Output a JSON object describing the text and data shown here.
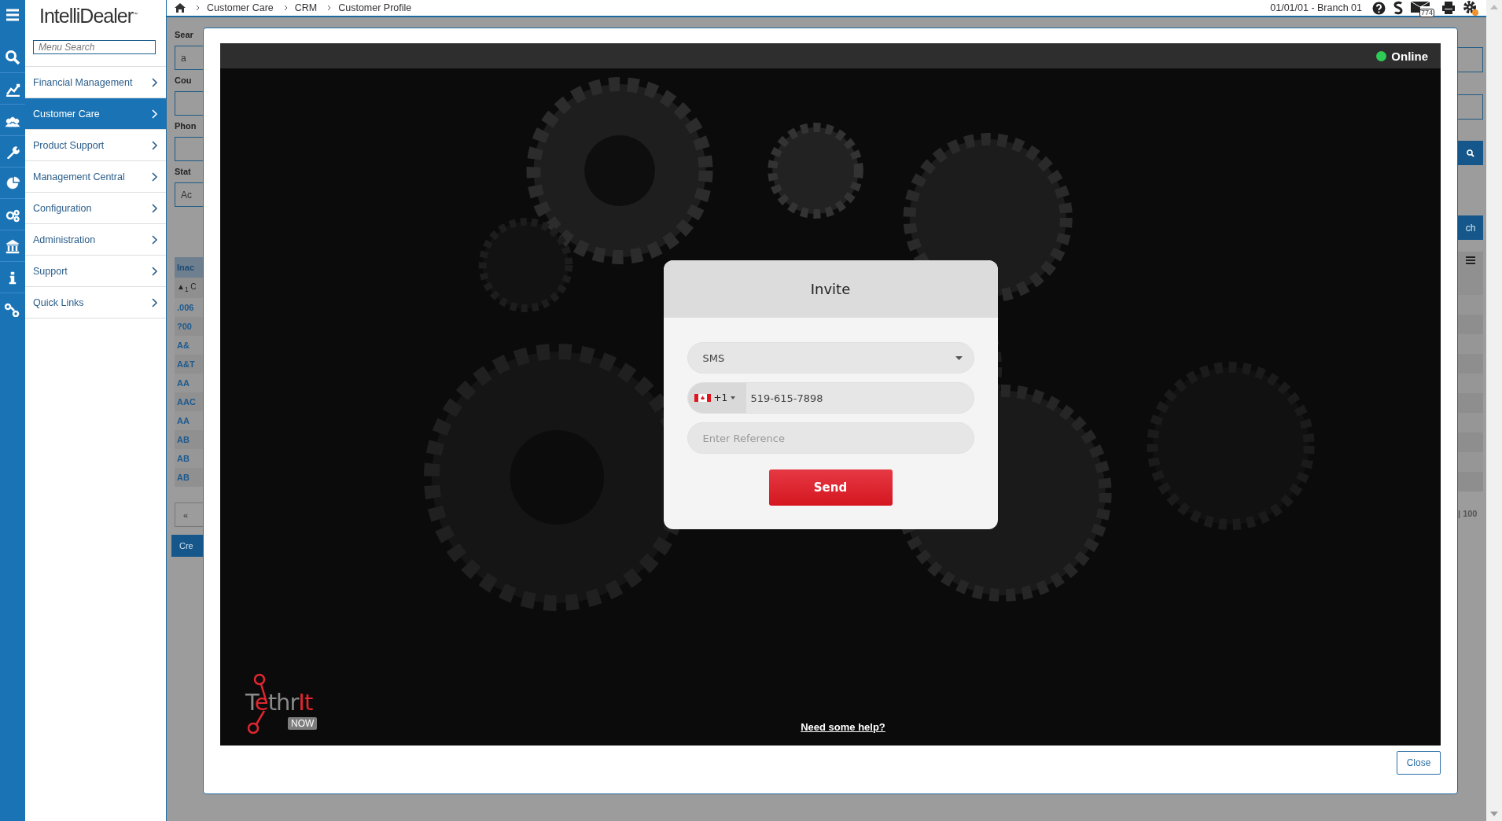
{
  "sidebar": {
    "logo": "IntelliDealer",
    "trademark": "™",
    "search_placeholder": "Menu Search",
    "items": [
      {
        "label": "Financial Management",
        "selected": false
      },
      {
        "label": "Customer Care",
        "selected": true
      },
      {
        "label": "Product Support",
        "selected": false
      },
      {
        "label": "Management Central",
        "selected": false
      },
      {
        "label": "Configuration",
        "selected": false
      },
      {
        "label": "Administration",
        "selected": false
      },
      {
        "label": "Support",
        "selected": false
      },
      {
        "label": "Quick Links",
        "selected": false
      }
    ]
  },
  "breadcrumb": [
    "Customer Care",
    "CRM",
    "Customer Profile"
  ],
  "branch": "01/01/01 - Branch 01",
  "mail_count": "774",
  "settings_alert": true,
  "background_page": {
    "search_label": "Sear",
    "search_value": "a",
    "country_label": "Cou",
    "phone_label": "Phon",
    "status_label": "Stat",
    "status_value": "Ac",
    "table_header": "Inac",
    "sort_header": "▲$_{1}$ C",
    "rows": [
      ".006",
      "?00",
      "A&",
      "A&T",
      "AA",
      "AAC",
      "AA",
      "AB",
      "AB",
      "AB"
    ],
    "pager": "«",
    "create_button": "Cre",
    "search_button_tail": "ch",
    "page_size": "| 100"
  },
  "modal": {
    "status": {
      "label": "Online",
      "online": true
    },
    "invite": {
      "title": "Invite",
      "method": "SMS",
      "country_code": "+1",
      "phone": "519-615-7898",
      "reference_placeholder": "Enter Reference",
      "send": "Send"
    },
    "logo": {
      "parts": [
        {
          "text": "T",
          "color": "#8a8a8a"
        },
        {
          "text": "e",
          "color": "#e0262f"
        },
        {
          "text": "thr",
          "color": "#8a8a8a"
        },
        {
          "text": "It",
          "color": "#e0262f"
        }
      ],
      "badge": "NOW"
    },
    "help_link": "Need some help?",
    "close": "Close"
  }
}
